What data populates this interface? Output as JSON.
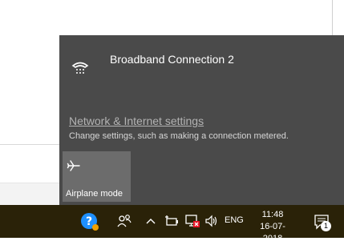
{
  "flyout": {
    "connection_name": "Broadband Connection 2",
    "connection_icon": "dialup-phone-icon",
    "settings_link": "Network & Internet settings",
    "settings_description": "Change settings, such as making a connection metered.",
    "quick_action": {
      "label": "Airplane mode",
      "icon": "airplane-icon",
      "active": false
    }
  },
  "taskbar": {
    "tray_icons": [
      "help-icon",
      "people-icon",
      "chevron-up-icon",
      "power-icon",
      "network-disconnected-icon",
      "volume-icon"
    ],
    "language": "ENG",
    "time": "11:48",
    "date": "16-07-2018",
    "notification_count": "1"
  },
  "colors": {
    "flyout_bg": "#4a4a4a",
    "tile_bg": "#6c6c6c",
    "taskbar_bg": "#2a2208",
    "error_red": "#e81123",
    "help_blue": "#1e90ff"
  }
}
